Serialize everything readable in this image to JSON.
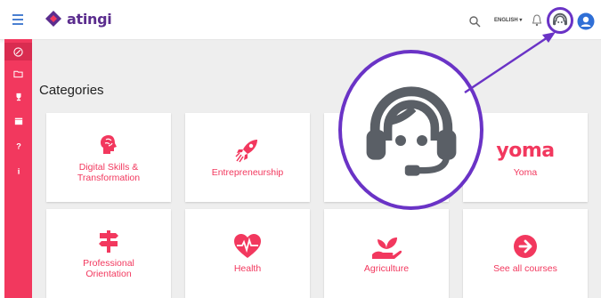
{
  "header": {
    "logo_text": "atingi",
    "language": "ENGLISH ▾",
    "icons": [
      "menu-icon",
      "search-icon",
      "bell-icon",
      "headset-icon",
      "account-icon"
    ]
  },
  "sidebar": {
    "items": [
      "compass-icon",
      "folder-icon",
      "trophy-icon",
      "calendar-icon",
      "help-icon",
      "info-icon"
    ]
  },
  "main": {
    "title": "Categories",
    "categories": [
      {
        "label": "Digital Skills & Transformation",
        "icon": "brain-icon"
      },
      {
        "label": "Entrepreneurship",
        "icon": "rocket-icon"
      },
      {
        "label": "",
        "icon": ""
      },
      {
        "label": "Yoma",
        "icon": "yoma-logo",
        "logo_text": "yoma"
      },
      {
        "label": "Professional Orientation",
        "icon": "signpost-icon"
      },
      {
        "label": "Health",
        "icon": "heart-pulse-icon"
      },
      {
        "label": "Agriculture",
        "icon": "plant-hand-icon"
      },
      {
        "label": "See all courses",
        "icon": "arrow-right-circle-icon"
      }
    ]
  },
  "colors": {
    "accent": "#f2385e",
    "brand": "#5b2d8e",
    "highlight": "#6a33c6",
    "icon_gray": "#5a5f66",
    "background": "#eeeeee"
  }
}
